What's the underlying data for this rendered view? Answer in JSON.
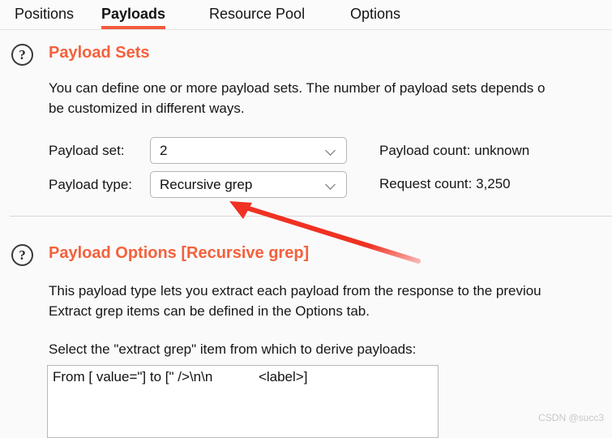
{
  "tabs": [
    {
      "label": "Positions",
      "active": false
    },
    {
      "label": "Payloads",
      "active": true
    },
    {
      "label": "Resource Pool",
      "active": false
    },
    {
      "label": "Options",
      "active": false
    }
  ],
  "colors": {
    "accent_orange": "#f4613c",
    "tab_underline": "#f15b3c",
    "annotation_red": "#f03123",
    "page_background": "#fafafa",
    "divider": "#d8d8d8"
  },
  "payload_sets": {
    "help_glyph": "?",
    "title": "Payload Sets",
    "description_line1": "You can define one or more payload sets. The number of payload sets depends o",
    "description_line2": "be customized in different ways.",
    "payload_set": {
      "label": "Payload set:",
      "value": "2"
    },
    "payload_type": {
      "label": "Payload type:",
      "value": "Recursive grep"
    },
    "payload_count": "Payload count:  unknown",
    "request_count": "Request count: 3,250"
  },
  "payload_options": {
    "help_glyph": "?",
    "title": "Payload Options [Recursive grep]",
    "description_line1": "This payload type lets you extract each payload from the response to the previou",
    "description_line2": "Extract grep items can be defined in the Options tab.",
    "select_prompt": "Select the \"extract grep\" item from which to derive payloads:",
    "items": [
      "From [ value=\"] to [\" />\\n\\n            <label>]"
    ]
  },
  "watermark": "CSDN @succ3"
}
